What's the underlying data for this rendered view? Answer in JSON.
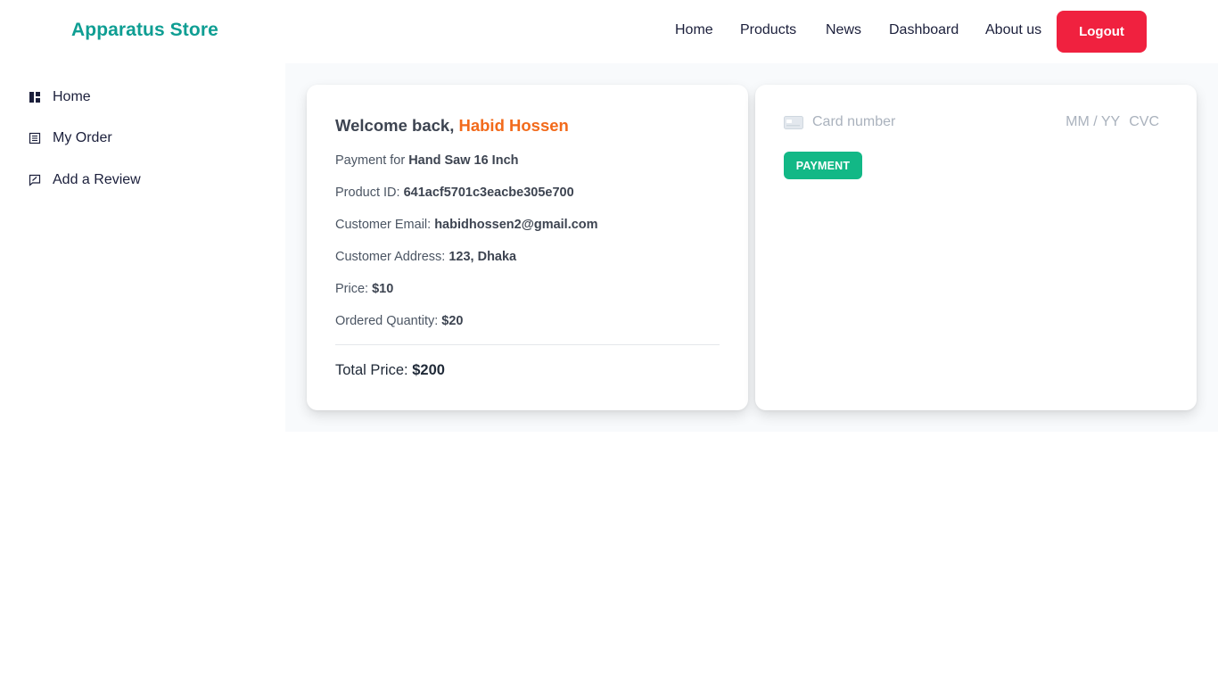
{
  "brand": "Apparatus Store",
  "nav": [
    "Home",
    "Products",
    "News",
    "Dashboard",
    "About us"
  ],
  "logout_label": "Logout",
  "sidebar": {
    "items": [
      {
        "label": "Home",
        "icon": "dashboard-icon"
      },
      {
        "label": "My Order",
        "icon": "list-icon"
      },
      {
        "label": "Add a Review",
        "icon": "review-icon"
      }
    ]
  },
  "order": {
    "welcome_prefix": "Welcome back,",
    "user_name": "Habid Hossen",
    "payment_for_label": "Payment for",
    "payment_for_value": "Hand Saw 16 Inch",
    "product_id_label": "Product ID:",
    "product_id_value": "641acf5701c3eacbe305e700",
    "email_label": "Customer Email:",
    "email_value": "habidhossen2@gmail.com",
    "address_label": "Customer Address:",
    "address_value": "123, Dhaka",
    "price_label": "Price:",
    "price_value": "$10",
    "quantity_label": "Ordered Quantity:",
    "quantity_value": "$20",
    "total_label": "Total Price:",
    "total_value": "$200"
  },
  "payment": {
    "card_placeholder": "Card number",
    "expiry_placeholder": "MM / YY",
    "cvc_placeholder": "CVC",
    "button_label": "PAYMENT"
  },
  "colors": {
    "brand": "#0f9e93",
    "logout": "#f0213f",
    "user_name": "#f26a1b",
    "payment_button": "#12b886"
  }
}
